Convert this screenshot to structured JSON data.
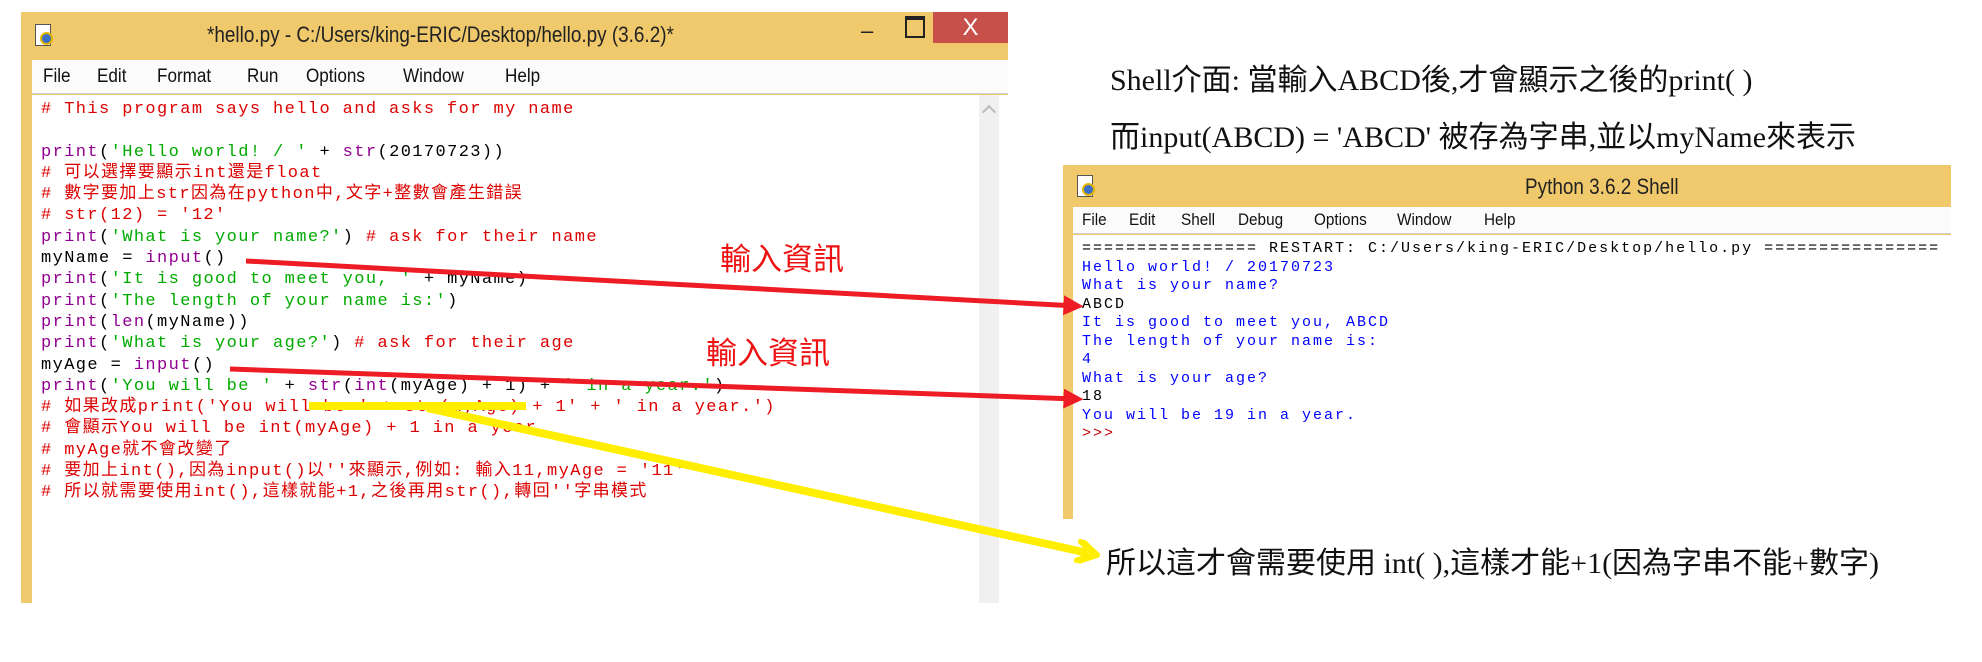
{
  "editor": {
    "title": "*hello.py - C:/Users/king-ERIC/Desktop/hello.py (3.6.2)*",
    "close_label": "X",
    "menu": [
      "File",
      "Edit",
      "Format",
      "Run",
      "Options",
      "Window",
      "Help"
    ],
    "lines": [
      [
        {
          "t": "# This program says hello and asks for my name",
          "c": "comment"
        }
      ],
      [],
      [
        {
          "t": "print",
          "c": "builtin"
        },
        {
          "t": "(",
          "c": "default"
        },
        {
          "t": "'Hello world! / '",
          "c": "string"
        },
        {
          "t": " + ",
          "c": "default"
        },
        {
          "t": "str",
          "c": "builtin"
        },
        {
          "t": "(20170723))",
          "c": "default"
        }
      ],
      [
        {
          "t": "# 可以選擇要顯示int還是float",
          "c": "comment"
        }
      ],
      [
        {
          "t": "# 數字要加上str因為在python中,文字+整數會產生錯誤",
          "c": "comment"
        }
      ],
      [
        {
          "t": "# str(12) = '12'",
          "c": "comment"
        }
      ],
      [
        {
          "t": "print",
          "c": "builtin"
        },
        {
          "t": "(",
          "c": "default"
        },
        {
          "t": "'What is your name?'",
          "c": "string"
        },
        {
          "t": ") ",
          "c": "default"
        },
        {
          "t": "# ask for their name",
          "c": "comment"
        }
      ],
      [
        {
          "t": "myName = ",
          "c": "default"
        },
        {
          "t": "input",
          "c": "builtin"
        },
        {
          "t": "()",
          "c": "default"
        }
      ],
      [
        {
          "t": "print",
          "c": "builtin"
        },
        {
          "t": "(",
          "c": "default"
        },
        {
          "t": "'It is good to meet you, '",
          "c": "string"
        },
        {
          "t": " + myName)",
          "c": "default"
        }
      ],
      [
        {
          "t": "print",
          "c": "builtin"
        },
        {
          "t": "(",
          "c": "default"
        },
        {
          "t": "'The length of your name is:'",
          "c": "string"
        },
        {
          "t": ")",
          "c": "default"
        }
      ],
      [
        {
          "t": "print",
          "c": "builtin"
        },
        {
          "t": "(",
          "c": "default"
        },
        {
          "t": "len",
          "c": "builtin"
        },
        {
          "t": "(myName))",
          "c": "default"
        }
      ],
      [
        {
          "t": "print",
          "c": "builtin"
        },
        {
          "t": "(",
          "c": "default"
        },
        {
          "t": "'What is your age?'",
          "c": "string"
        },
        {
          "t": ") ",
          "c": "default"
        },
        {
          "t": "# ask for their age",
          "c": "comment"
        }
      ],
      [
        {
          "t": "myAge = ",
          "c": "default"
        },
        {
          "t": "input",
          "c": "builtin"
        },
        {
          "t": "()",
          "c": "default"
        }
      ],
      [
        {
          "t": "print",
          "c": "builtin"
        },
        {
          "t": "(",
          "c": "default"
        },
        {
          "t": "'You will be '",
          "c": "string"
        },
        {
          "t": " + ",
          "c": "default"
        },
        {
          "t": "str",
          "c": "builtin"
        },
        {
          "t": "(",
          "c": "default"
        },
        {
          "t": "int",
          "c": "builtin"
        },
        {
          "t": "(myAge) + 1) + ",
          "c": "default"
        },
        {
          "t": "' in a year.'",
          "c": "string"
        },
        {
          "t": ")",
          "c": "default"
        }
      ],
      [
        {
          "t": "# 如果改成print('You will be ' + str(myAge) + 1' + ' in a year.')",
          "c": "comment"
        }
      ],
      [
        {
          "t": "# 會顯示You will be int(myAge) + 1 in a year.",
          "c": "comment"
        }
      ],
      [
        {
          "t": "# myAge就不會改變了",
          "c": "comment"
        }
      ],
      [
        {
          "t": "# 要加上int(),因為input()以''來顯示,例如: 輸入11,myAge = '11'",
          "c": "comment"
        }
      ],
      [
        {
          "t": "# 所以就需要使用int(),這樣就能+1,之後再用str(),轉回''字串模式",
          "c": "comment"
        }
      ]
    ]
  },
  "shell": {
    "title": "Python 3.6.2 Shell",
    "menu": [
      "File",
      "Edit",
      "Shell",
      "Debug",
      "Options",
      "Window",
      "Help"
    ],
    "lines": [
      {
        "t": "================ RESTART: C:/Users/king-ERIC/Desktop/hello.py ================",
        "c": "default"
      },
      {
        "t": "Hello world! / 20170723",
        "c": "stdout"
      },
      {
        "t": "What is your name?",
        "c": "stdout"
      },
      {
        "t": "ABCD",
        "c": "default"
      },
      {
        "t": "It is good to meet you, ABCD",
        "c": "stdout"
      },
      {
        "t": "The length of your name is:",
        "c": "stdout"
      },
      {
        "t": "4",
        "c": "stdout"
      },
      {
        "t": "What is your age?",
        "c": "stdout"
      },
      {
        "t": "18",
        "c": "default"
      },
      {
        "t": "You will be 19 in a year.",
        "c": "stdout"
      },
      {
        "t": ">>>",
        "c": "prompt"
      }
    ]
  },
  "annotations": {
    "shell_note_1": "Shell介面: 當輸入ABCD後,才會顯示之後的print( )",
    "shell_note_2": "而input(ABCD) = 'ABCD' 被存為字串,並以myName來表示",
    "input_label_1": "輸入資訊",
    "input_label_2": "輸入資訊",
    "int_note": "所以這才會需要使用 int( ),這樣才能+1(因為字串不能+數字)"
  },
  "colors": {
    "window_frame": "#f0c96c",
    "close_button": "#c7504a",
    "comment": "#dd0000",
    "builtin": "#900090",
    "string": "#00aa00",
    "stdout": "#0000ff",
    "red_arrow": "#ee1c24",
    "yellow_arrow": "#ffee00"
  }
}
